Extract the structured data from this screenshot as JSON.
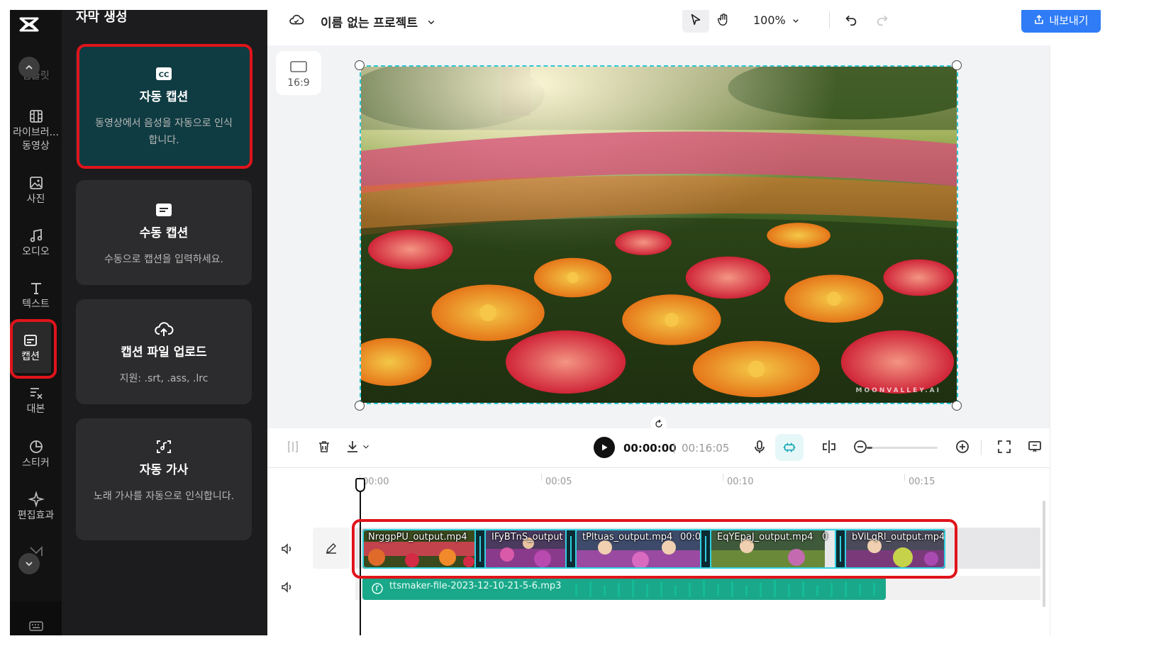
{
  "rail": {
    "items": [
      {
        "name": "templates",
        "label": "템플릿"
      },
      {
        "name": "library-video",
        "label": "라이브러..."
      },
      {
        "name": "library-video-2",
        "label": "동영상"
      },
      {
        "name": "photos",
        "label": "사진"
      },
      {
        "name": "audio",
        "label": "오디오"
      },
      {
        "name": "text",
        "label": "텍스트"
      },
      {
        "name": "captions",
        "label": "캡션"
      },
      {
        "name": "script",
        "label": "대본"
      },
      {
        "name": "stickers",
        "label": "스티커"
      },
      {
        "name": "effects",
        "label": "편집효과"
      }
    ]
  },
  "panel": {
    "title": "자막 생성",
    "cards": [
      {
        "title": "자동 캡션",
        "desc": "동영상에서 음성을 자동으로 인식합니다.",
        "icon": "cc-icon"
      },
      {
        "title": "수동 캡션",
        "desc": "수동으로 캡션을 입력하세요.",
        "icon": "subtitle-icon"
      },
      {
        "title": "캡션 파일 업로드",
        "desc": "지원: .srt, .ass, .lrc",
        "icon": "cloud-upload-icon"
      },
      {
        "title": "자동 가사",
        "desc": "노래 가사를 자동으로 인식합니다.",
        "icon": "lyrics-scan-icon"
      }
    ]
  },
  "topbar": {
    "project_name": "이름 없는 프로젝트",
    "zoom": "100%",
    "export_label": "내보내기"
  },
  "preview": {
    "ratio": "16:9",
    "watermark": "MOONVALLEY.AI"
  },
  "controls": {
    "current_time": "00:00:00",
    "separator": "|",
    "total_time": "00:16:05",
    "zoom_level": 0.08
  },
  "timeline": {
    "ruler": [
      "00:00",
      "00:05",
      "00:10",
      "00:15"
    ],
    "clips": [
      {
        "name": "NrggpPU_output.mp4"
      },
      {
        "name": "IFyBTnS_output"
      },
      {
        "name": "tPltuas_output.mp4"
      },
      {
        "name": "00:0"
      },
      {
        "name": "EqYEpaJ_output.mp4"
      },
      {
        "name": "0"
      },
      {
        "name": "bViLqRl_output.mp4"
      }
    ],
    "audio": {
      "name": "ttsmaker-file-2023-12-10-21-5-6.mp3"
    }
  },
  "colors": {
    "accent": "#2fd0e0",
    "highlight": "#e0141b",
    "export": "#2f7cf6",
    "audio_clip": "#1aa88a"
  }
}
